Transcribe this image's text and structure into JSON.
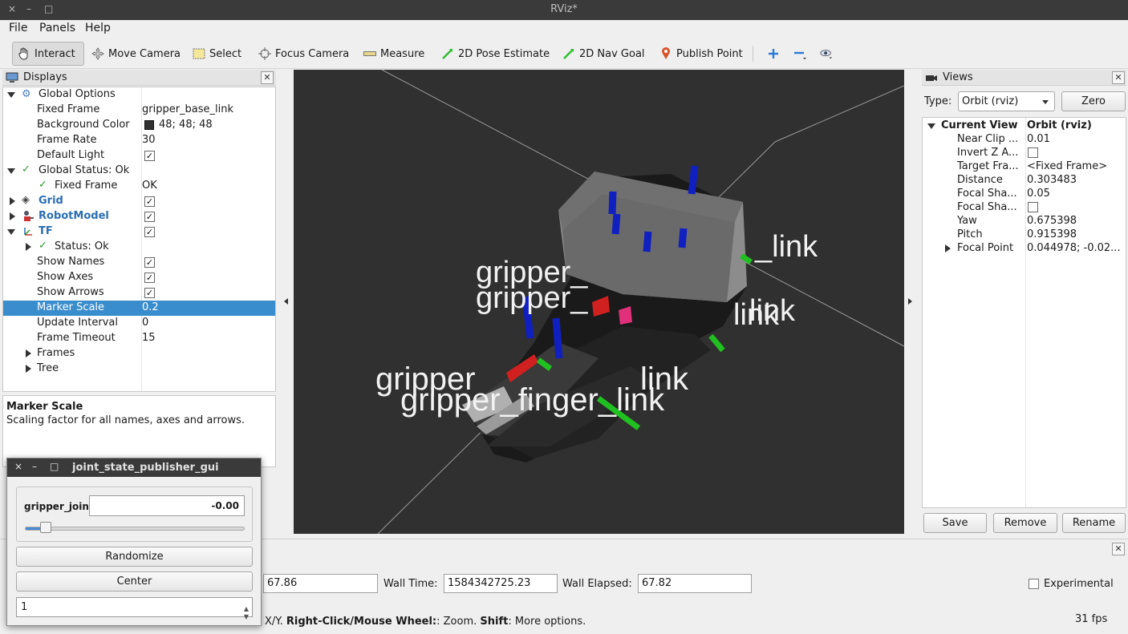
{
  "window": {
    "title": "RViz*",
    "controls": [
      "×",
      "–",
      "□"
    ]
  },
  "menu": [
    "File",
    "Panels",
    "Help"
  ],
  "toolbar": {
    "tools": [
      "Interact",
      "Move Camera",
      "Select",
      "Focus Camera",
      "Measure",
      "2D Pose Estimate",
      "2D Nav Goal",
      "Publish Point"
    ]
  },
  "displays": {
    "title": "Displays",
    "rows": [
      {
        "label": "Global Options",
        "value": ""
      },
      {
        "label": "Fixed Frame",
        "value": "gripper_base_link"
      },
      {
        "label": "Background Color",
        "value": "48; 48; 48"
      },
      {
        "label": "Frame Rate",
        "value": "30"
      },
      {
        "label": "Default Light",
        "value": ""
      },
      {
        "label": "Global Status: Ok",
        "value": ""
      },
      {
        "label": "Fixed Frame",
        "value": "OK"
      },
      {
        "label": "Grid",
        "value": ""
      },
      {
        "label": "RobotModel",
        "value": ""
      },
      {
        "label": "TF",
        "value": ""
      },
      {
        "label": "Status: Ok",
        "value": ""
      },
      {
        "label": "Show Names",
        "value": ""
      },
      {
        "label": "Show Axes",
        "value": ""
      },
      {
        "label": "Show Arrows",
        "value": ""
      },
      {
        "label": "Marker Scale",
        "value": "0.2"
      },
      {
        "label": "Update Interval",
        "value": "0"
      },
      {
        "label": "Frame Timeout",
        "value": "15"
      },
      {
        "label": "Frames",
        "value": ""
      },
      {
        "label": "Tree",
        "value": ""
      }
    ],
    "description_title": "Marker Scale",
    "description_text": "Scaling factor for all names, axes and arrows."
  },
  "viewport": {
    "labels": [
      "gripper_",
      "gripper_",
      "_link",
      "link",
      "gripper",
      "link",
      "gripper_finger_link",
      "link"
    ]
  },
  "views": {
    "title": "Views",
    "type_label": "Type:",
    "type_value": "Orbit (rviz)",
    "zero_label": "Zero",
    "rows": [
      {
        "label": "Current View",
        "value": "Orbit (rviz)"
      },
      {
        "label": "Near Clip ...",
        "value": "0.01"
      },
      {
        "label": "Invert Z A...",
        "value": ""
      },
      {
        "label": "Target Fra...",
        "value": "<Fixed Frame>"
      },
      {
        "label": "Distance",
        "value": "0.303483"
      },
      {
        "label": "Focal Sha...",
        "value": "0.05"
      },
      {
        "label": "Focal Sha...",
        "value": ""
      },
      {
        "label": "Yaw",
        "value": "0.675398"
      },
      {
        "label": "Pitch",
        "value": "0.915398"
      },
      {
        "label": "Focal Point",
        "value": "0.044978; -0.02..."
      }
    ],
    "buttons": [
      "Save",
      "Remove",
      "Rename"
    ]
  },
  "time": {
    "ros_elapsed": "67.86",
    "wall_time_label": "Wall Time:",
    "wall_time": "1584342725.23",
    "wall_elapsed_label": "Wall Elapsed:",
    "wall_elapsed": "67.82",
    "experimental_label": "Experimental",
    "hint_a": "X/Y. ",
    "hint_b": "Right-Click/Mouse Wheel:",
    "hint_c": ": Zoom. ",
    "hint_d": "Shift",
    "hint_e": ": More options.",
    "fps": "31 fps"
  },
  "joint_gui": {
    "title": "joint_state_publisher_gui",
    "joint_name": "gripper_joint",
    "joint_value": "-0.00",
    "slider_fraction": 0.07,
    "randomize": "Randomize",
    "center": "Center",
    "spin_value": "1"
  }
}
